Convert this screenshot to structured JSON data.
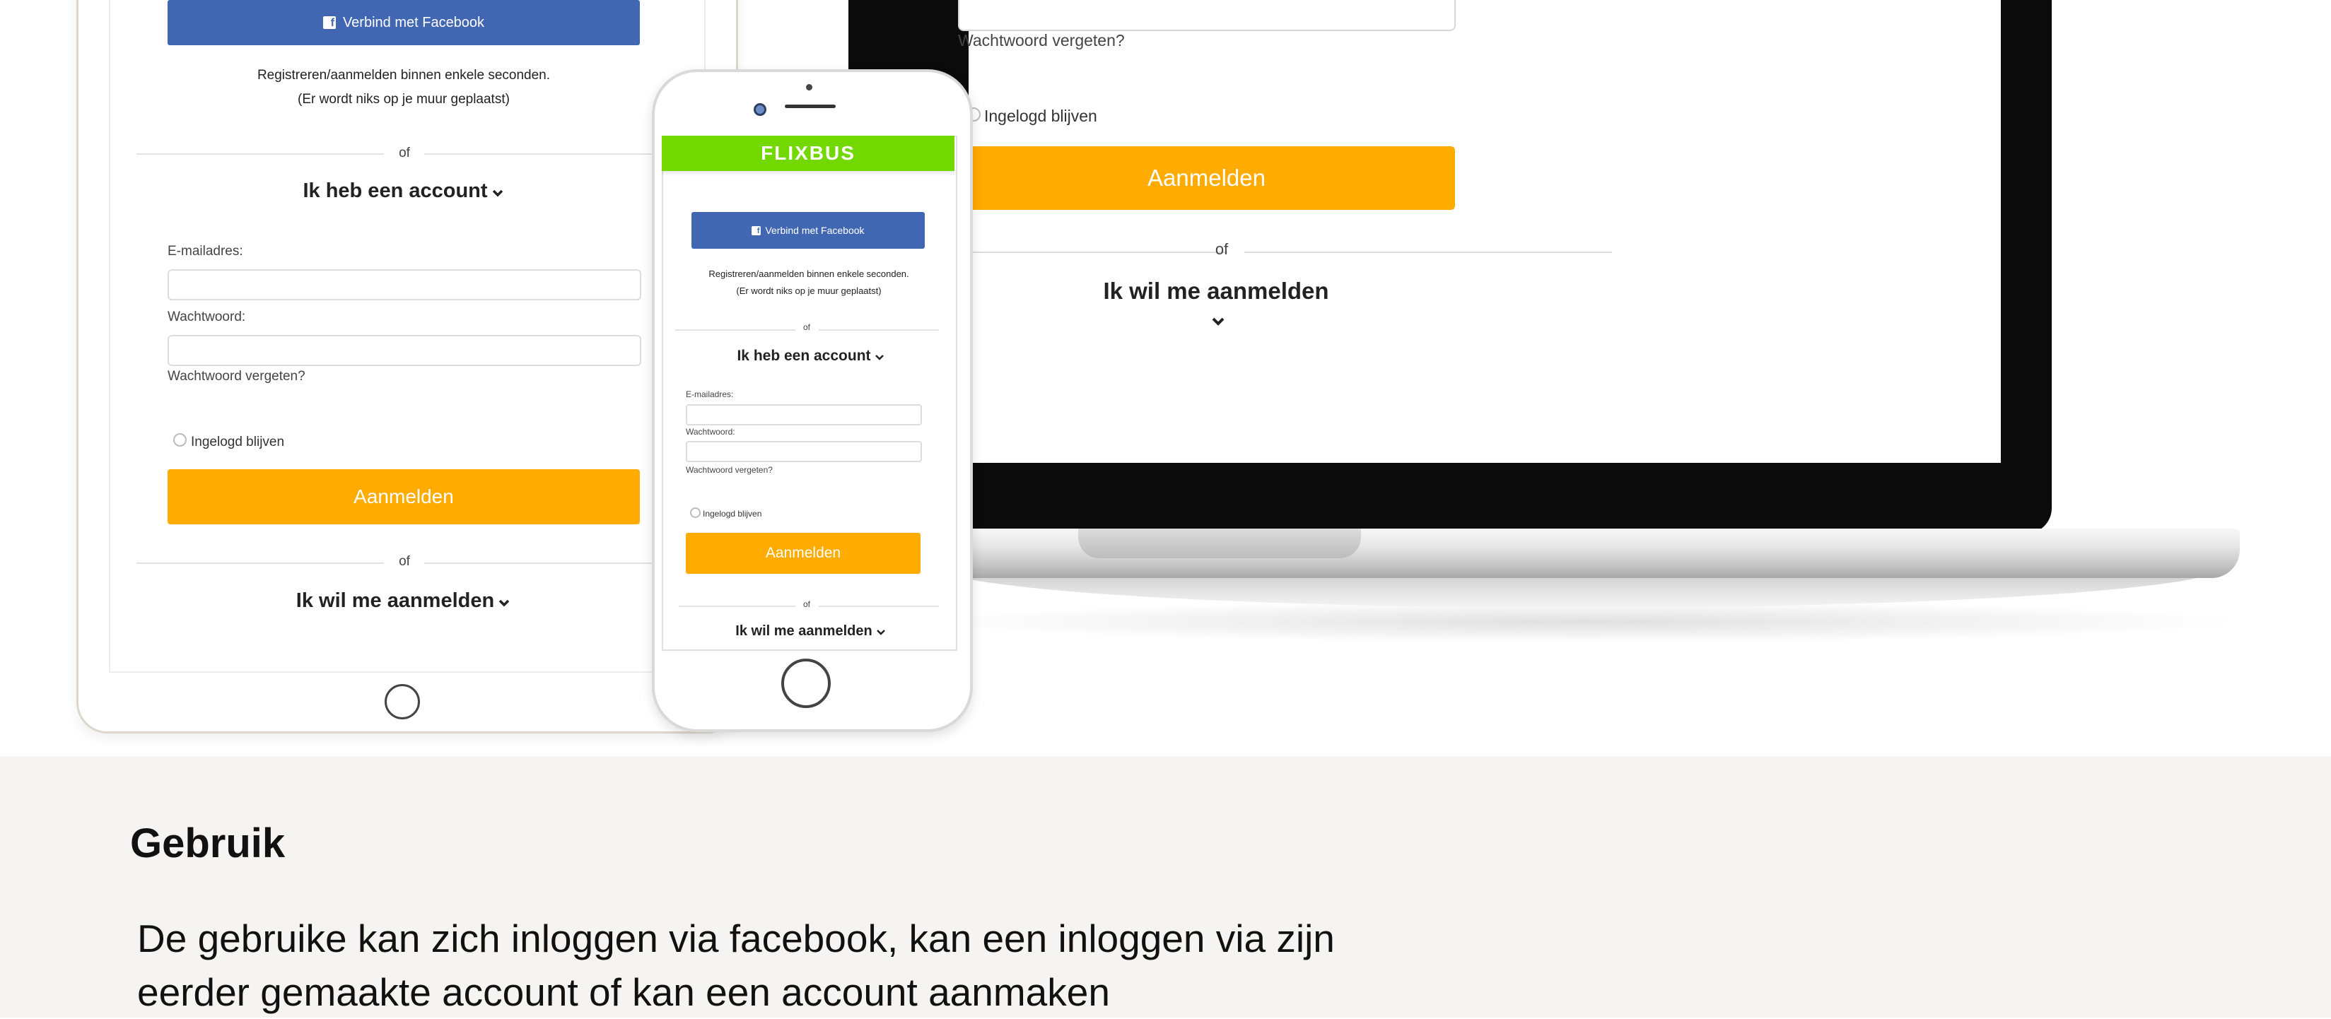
{
  "laptop": {
    "forgot_password": "Wachtwoord vergeten?",
    "remember_me": "Ingelogd blijven",
    "login_button": "Aanmelden",
    "or": "of",
    "signup_toggle": "Ik wil me aanmelden"
  },
  "tablet": {
    "facebook_button": "Verbind met Facebook",
    "register_line1": "Registreren/aanmelden binnen enkele seconden.",
    "register_line2": "(Er wordt niks op je muur geplaatst)",
    "or": "of",
    "account_toggle": "Ik heb een account",
    "email_label": "E-mailadres:",
    "password_label": "Wachtwoord:",
    "forgot_password": "Wachtwoord vergeten?",
    "remember_me": "Ingelogd blijven",
    "login_button": "Aanmelden",
    "signup_toggle": "Ik wil me aanmelden"
  },
  "phone": {
    "brand": "FLIXBUS",
    "facebook_button": "Verbind met Facebook",
    "register_line1": "Registreren/aanmelden binnen enkele seconden.",
    "register_line2": "(Er wordt niks op je muur geplaatst)",
    "or": "of",
    "account_toggle": "Ik heb een account",
    "email_label": "E-mailadres:",
    "password_label": "Wachtwoord:",
    "forgot_password": "Wachtwoord vergeten?",
    "remember_me": "Ingelogd blijven",
    "login_button": "Aanmelden",
    "signup_toggle": "Ik wil me aanmelden"
  },
  "section": {
    "title": "Gebruik",
    "body_line1": "De gebruike kan zich inloggen via facebook, kan een inloggen via zijn",
    "body_line2": "eerder gemaakte account of kan een account aanmaken"
  },
  "icons": {
    "facebook": "facebook-icon",
    "chevron": "chevron-down-icon"
  },
  "colors": {
    "facebook_blue": "#4267b2",
    "login_orange": "#ffab00",
    "flixbus_green": "#73d700",
    "section_bg": "#f5f4f2"
  }
}
